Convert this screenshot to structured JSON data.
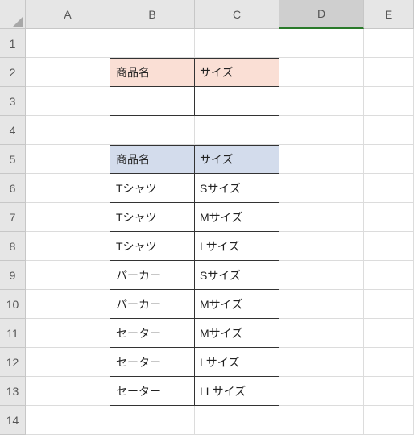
{
  "columns": [
    "A",
    "B",
    "C",
    "D",
    "E"
  ],
  "selectedColumn": "D",
  "rowCount": 14,
  "criteria": {
    "header": {
      "product": "商品名",
      "size": "サイズ"
    },
    "row": {
      "product": "",
      "size": ""
    }
  },
  "table": {
    "header": {
      "product": "商品名",
      "size": "サイズ"
    },
    "rows": [
      {
        "product": "Tシャツ",
        "size": "Sサイズ"
      },
      {
        "product": "Tシャツ",
        "size": "Mサイズ"
      },
      {
        "product": "Tシャツ",
        "size": "Lサイズ"
      },
      {
        "product": "パーカー",
        "size": "Sサイズ"
      },
      {
        "product": "パーカー",
        "size": "Mサイズ"
      },
      {
        "product": "セーター",
        "size": "Mサイズ"
      },
      {
        "product": "セーター",
        "size": "Lサイズ"
      },
      {
        "product": "セーター",
        "size": "LLサイズ"
      }
    ]
  }
}
